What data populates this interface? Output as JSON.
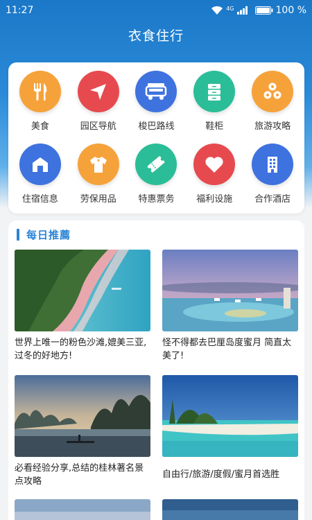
{
  "status": {
    "time": "11:27",
    "network": "4G",
    "battery": "100 %"
  },
  "header": {
    "title": "衣食住行"
  },
  "services": [
    {
      "label": "美食",
      "icon": "cutlery-icon",
      "color": "#f6a23b"
    },
    {
      "label": "园区导航",
      "icon": "navigation-arrow-icon",
      "color": "#e64a4f"
    },
    {
      "label": "梭巴路线",
      "icon": "shuttle-bus-icon",
      "color": "#3e72de"
    },
    {
      "label": "鞋柜",
      "icon": "cabinet-icon",
      "color": "#2bbd97"
    },
    {
      "label": "旅游攻略",
      "icon": "travel-guide-icon",
      "color": "#f6a23b"
    },
    {
      "label": "住宿信息",
      "icon": "house-icon",
      "color": "#3e72de"
    },
    {
      "label": "劳保用品",
      "icon": "shirt-icon",
      "color": "#f6a23b"
    },
    {
      "label": "特惠票务",
      "icon": "ticket-icon",
      "color": "#2bbd97"
    },
    {
      "label": "福利设施",
      "icon": "heart-icon",
      "color": "#e64a4f"
    },
    {
      "label": "合作酒店",
      "icon": "hotel-building-icon",
      "color": "#3e72de"
    }
  ],
  "recommend": {
    "title": "每日推薦",
    "items": [
      {
        "text": "世界上唯一的粉色沙滩,媲美三亚,过冬的好地方!",
        "image": "pink-beach-image"
      },
      {
        "text": "怪不得都去巴厘岛度蜜月 简直太美了!",
        "image": "bali-resort-image"
      },
      {
        "text": "必看经验分享,总结的桂林著名景点攻略",
        "image": "guilin-river-image"
      },
      {
        "text": "自由行/旅游/度假/蜜月首选胜",
        "image": "maldives-beach-image"
      }
    ]
  }
}
